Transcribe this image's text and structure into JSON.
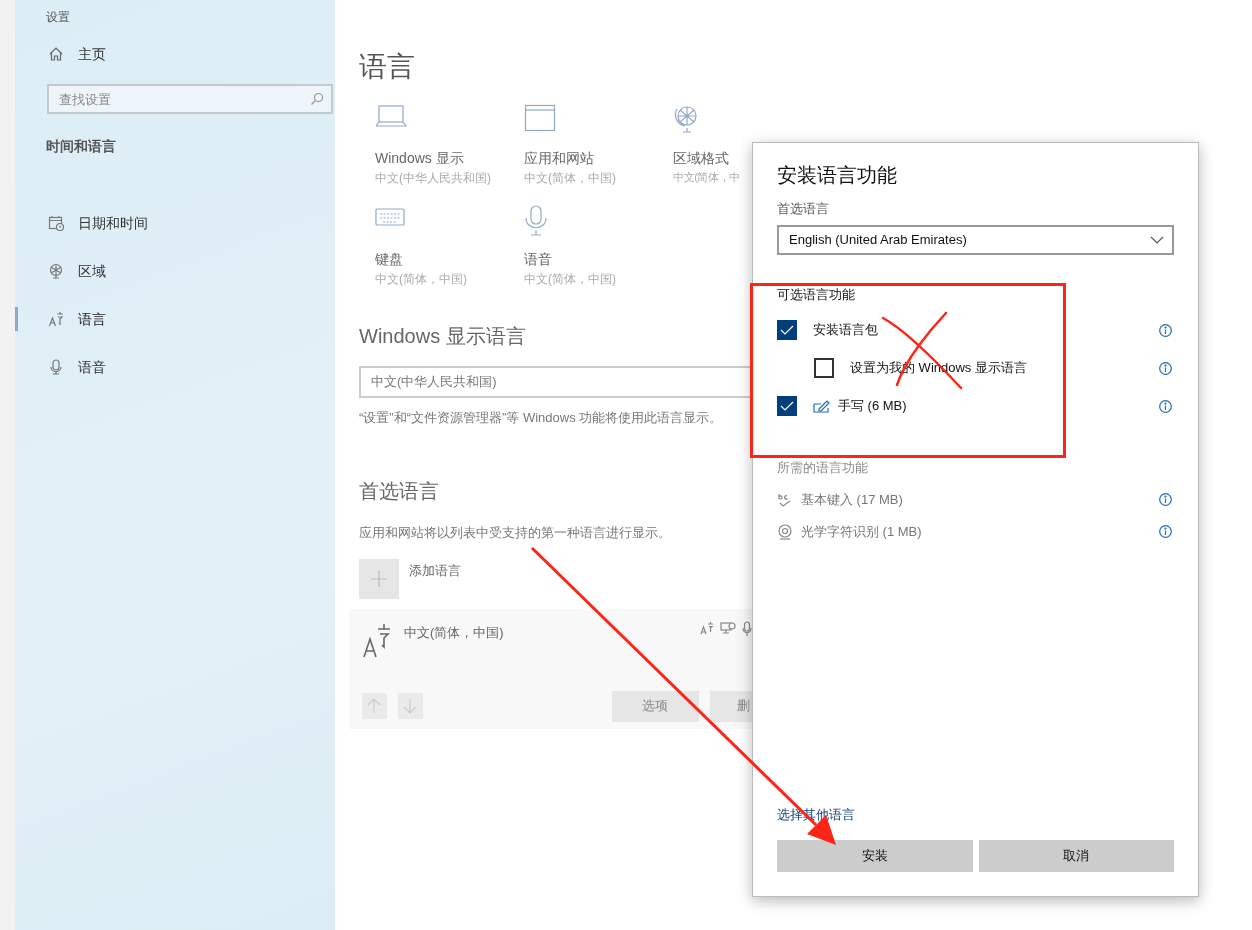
{
  "window": {
    "title": "设置"
  },
  "sidebar": {
    "home": "主页",
    "search": {
      "placeholder": "查找设置"
    },
    "section": "时间和语言",
    "items": [
      {
        "label": "日期和时间",
        "selected": false
      },
      {
        "label": "区域",
        "selected": false
      },
      {
        "label": "语言",
        "selected": true
      },
      {
        "label": "语音",
        "selected": false
      }
    ]
  },
  "page": {
    "title": "语言",
    "tiles": [
      {
        "label": "Windows 显示",
        "value": "中文(中华人民共和国)"
      },
      {
        "label": "应用和网站",
        "value": "中文(简体，中国)"
      },
      {
        "label": "区域格式",
        "value": "中文(简体，中"
      },
      {
        "label": "键盘",
        "value": "中文(简体，中国)"
      },
      {
        "label": "语音",
        "value": "中文(简体，中国)"
      }
    ],
    "display_language": {
      "heading": "Windows 显示语言",
      "value": "中文(中华人民共和国)",
      "note": "“设置”和“文件资源管理器”等 Windows 功能将使用此语言显示。"
    },
    "preferred": {
      "heading": "首选语言",
      "note": "应用和网站将以列表中受支持的第一种语言进行显示。",
      "add_label": "添加语言",
      "languages": [
        {
          "name": "中文(简体，中国)",
          "buttons": [
            "选项",
            "删"
          ]
        }
      ]
    }
  },
  "dialog": {
    "title": "安装语言功能",
    "language_label": "首选语言",
    "language": "English (United Arab Emirates)",
    "optional_heading": "可选语言功能",
    "optional": [
      {
        "label": "安装语言包",
        "checked": true,
        "children": [
          {
            "label": "设置为我的 Windows 显示语言",
            "checked": false
          }
        ]
      },
      {
        "label": "手写 (6 MB)",
        "checked": true
      }
    ],
    "required_heading": "所需的语言功能",
    "required": [
      {
        "label": "基本键入 (17 MB)"
      },
      {
        "label": "光学字符识别 (1 MB)"
      }
    ],
    "link": "选择其他语言",
    "buttons": [
      {
        "label": "安装"
      },
      {
        "label": "取消"
      }
    ]
  }
}
